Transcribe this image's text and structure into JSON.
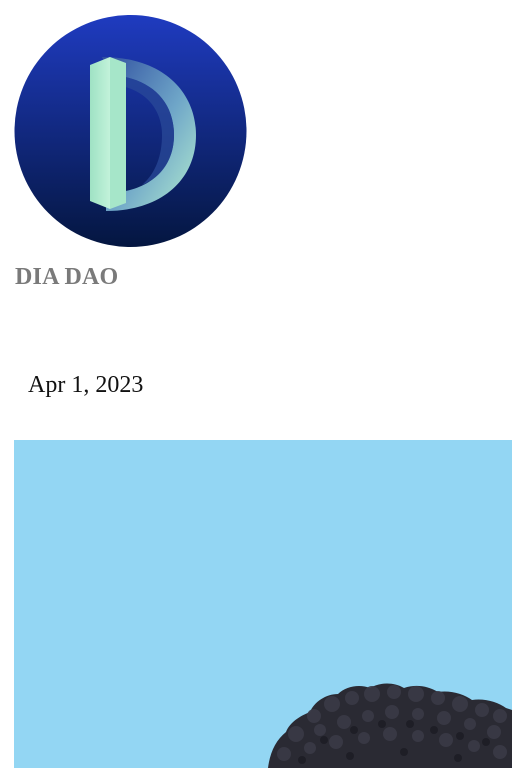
{
  "author": {
    "name": "DIA DAO",
    "avatar_icon": "dia-dao-logo-icon",
    "avatar_colors": {
      "circle_top": "#1f3bc0",
      "circle_bottom": "#041640",
      "letter_light": "#b3ecd0",
      "letter_dark": "#3d5fa8"
    }
  },
  "post": {
    "date": "Apr 1, 2023"
  },
  "hero_image": {
    "icon": "hero-image-sky-with-dark-object",
    "colors": {
      "sky": "#93d6f3",
      "object": "#2a2a33"
    }
  }
}
